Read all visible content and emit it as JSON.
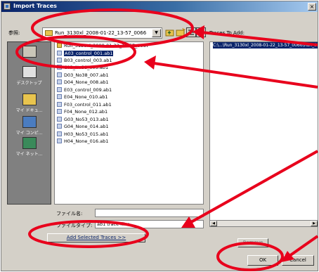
{
  "window": {
    "title": "Import Traces",
    "close_glyph": "×"
  },
  "lookin": {
    "label": "参照:",
    "path": "Run_3130xl_2008-01-22_13-57_0066",
    "dropdown_glyph": "▼"
  },
  "places": [
    {
      "label": "",
      "icon": "history-icon"
    },
    {
      "label": "デスクトップ",
      "icon": "desktop-icon"
    },
    {
      "label": "マイ ドキュ...",
      "icon": "my-documents-icon"
    },
    {
      "label": "マイ コンピ...",
      "icon": "my-computer-icon"
    },
    {
      "label": "マイ ネット...",
      "icon": "my-network-icon"
    }
  ],
  "files": [
    {
      "name": "Run_3130xl_2008-01-22_13-57_0067",
      "type": "folder",
      "selected": false
    },
    {
      "name": "A03_control_001.ab1",
      "type": "file",
      "selected": true
    },
    {
      "name": "B03_control_003.ab1",
      "type": "file",
      "selected": false
    },
    {
      "name": "C03_No38_005.ab1",
      "type": "file",
      "selected": false
    },
    {
      "name": "D03_No38_007.ab1",
      "type": "file",
      "selected": false
    },
    {
      "name": "D04_None_008.ab1",
      "type": "file",
      "selected": false
    },
    {
      "name": "E03_control_009.ab1",
      "type": "file",
      "selected": false
    },
    {
      "name": "E04_None_010.ab1",
      "type": "file",
      "selected": false
    },
    {
      "name": "F03_control_011.ab1",
      "type": "file",
      "selected": false
    },
    {
      "name": "F04_None_012.ab1",
      "type": "file",
      "selected": false
    },
    {
      "name": "G03_No53_013.ab1",
      "type": "file",
      "selected": false
    },
    {
      "name": "G04_None_014.ab1",
      "type": "file",
      "selected": false
    },
    {
      "name": "H03_No53_015.ab1",
      "type": "file",
      "selected": false
    },
    {
      "name": "H04_None_016.ab1",
      "type": "file",
      "selected": false
    }
  ],
  "filename": {
    "label": "ファイル名:",
    "value": ""
  },
  "filetype": {
    "label": "ファイルタイプ:",
    "value": "ab1 trace files"
  },
  "traces": {
    "label": "Traces To Add:",
    "items": [
      "C:\\...\\Run_3130xl_2008-01-22_13-57_0066\\Run_3130xl_2008-01-2"
    ]
  },
  "buttons": {
    "add_selected": "Add Selected Traces >>",
    "remove": "Remove",
    "ok": "OK",
    "cancel": "Cancel"
  },
  "colors": {
    "annotation": "#e8001c",
    "selection": "#0a246a"
  }
}
